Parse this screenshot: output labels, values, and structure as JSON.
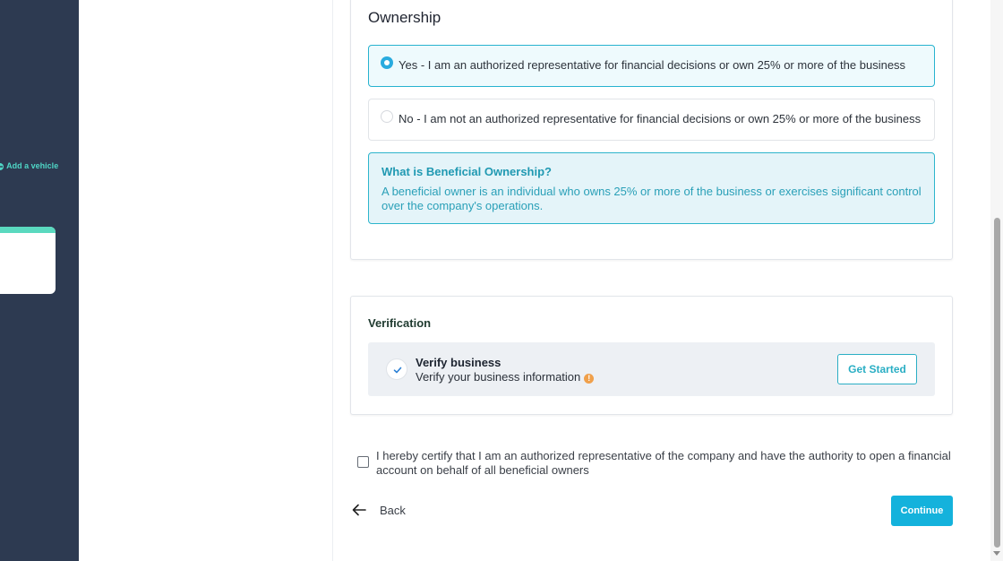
{
  "sidebar": {
    "add_vehicle_label": "Add a vehicle"
  },
  "ownership": {
    "title": "Ownership",
    "options": [
      {
        "label": "Yes - I am an authorized representative for financial decisions or own 25% or more of the business",
        "selected": true
      },
      {
        "label": "No - I am not an authorized representative for financial decisions or own 25% or more of the business",
        "selected": false
      }
    ],
    "info": {
      "title": "What is Beneficial Ownership?",
      "body": "A beneficial owner is an individual who owns 25% or more of the business or exercises significant control over the company's operations."
    }
  },
  "verification": {
    "title": "Verification",
    "item_name": "Verify business",
    "item_desc": "Verify your business information",
    "button_label": "Get Started"
  },
  "certify": {
    "text": "I hereby certify that I am an authorized representative of the company and have the authority to open a financial account on behalf of all beneficial owners",
    "checked": false
  },
  "footer": {
    "back_label": "Back",
    "continue_label": "Continue"
  },
  "colors": {
    "sidebar_bg": "#2d3a51",
    "accent": "#14b2dc",
    "teal_text": "#2aa0b8"
  },
  "icons": [
    "plus-icon",
    "radio-selected-icon",
    "radio-unselected-icon",
    "checkmark-icon",
    "warning-icon",
    "arrow-left-icon"
  ]
}
